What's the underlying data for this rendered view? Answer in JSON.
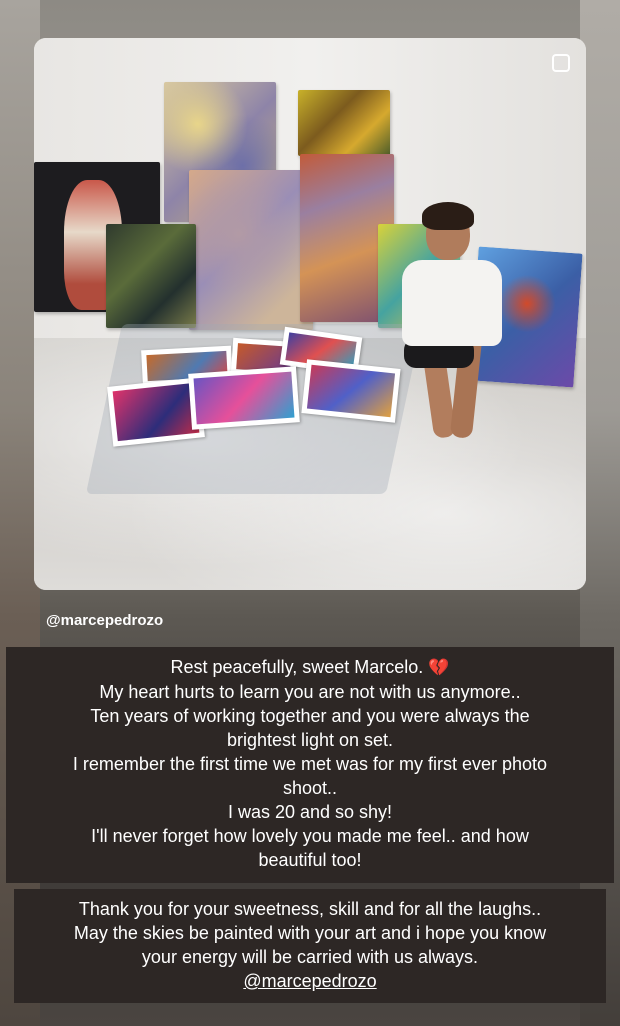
{
  "story": {
    "post": {
      "author_tag": "@marcepedrozo",
      "image_description_icon": "multi-photo-icon"
    },
    "caption": {
      "block1_lines": [
        "Rest peacefully, sweet Marcelo.",
        "My heart hurts to learn you are not with us anymore..",
        "Ten years of working together and you were always the",
        "brightest light on set.",
        "I remember the first time we met was for my first ever photo",
        "shoot..",
        "I was 20 and so shy!",
        "I'll never forget how lovely you made me feel.. and how",
        "beautiful too!"
      ],
      "broken_heart": "💔",
      "block2_lines": [
        "Thank you for your sweetness, skill and for all the laughs..",
        "May the skies be painted with your art and i hope you know",
        "your energy will be carried with us always."
      ],
      "mention": "@marcepedrozo"
    },
    "colors": {
      "caption_bg": "#2d2725",
      "caption_text": "#ffffff",
      "heart": "#d1352f"
    }
  }
}
